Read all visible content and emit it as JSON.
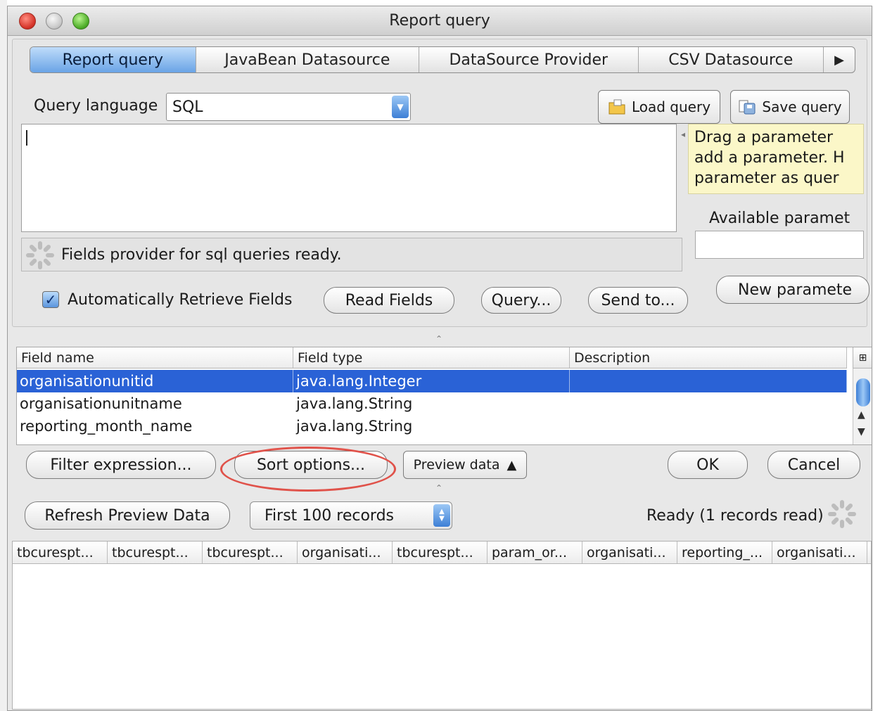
{
  "window": {
    "title": "Report query"
  },
  "tabs": [
    "Report query",
    "JavaBean Datasource",
    "DataSource Provider",
    "CSV Datasource"
  ],
  "query": {
    "language_label": "Query language",
    "language_value": "SQL",
    "load_label": "Load query",
    "save_label": "Save query",
    "text": "",
    "status": "Fields provider for sql queries ready.",
    "auto_retrieve_label": "Automatically Retrieve Fields",
    "auto_retrieve_checked": true,
    "read_fields_label": "Read Fields",
    "query_designer_label": "Query...",
    "send_to_label": "Send to..."
  },
  "parameters": {
    "hint_lines": [
      "Drag a parameter",
      "add a parameter. H",
      "parameter as quer"
    ],
    "available_label": "Available paramet",
    "new_label": "New paramete"
  },
  "fields": {
    "headers": [
      "Field name",
      "Field type",
      "Description"
    ],
    "rows": [
      {
        "name": "organisationunitid",
        "type": "java.lang.Integer",
        "description": "",
        "selected": true
      },
      {
        "name": "organisationunitname",
        "type": "java.lang.String",
        "description": "",
        "selected": false
      },
      {
        "name": "reporting_month_name",
        "type": "java.lang.String",
        "description": "",
        "selected": false
      }
    ]
  },
  "actions": {
    "filter_label": "Filter expression...",
    "sort_label": "Sort options...",
    "preview_label": "Preview data",
    "ok_label": "OK",
    "cancel_label": "Cancel"
  },
  "preview": {
    "refresh_label": "Refresh Preview Data",
    "records_value": "First 100 records",
    "status": "Ready (1 records read)",
    "columns": [
      "tbcurespt...",
      "tbcurespt...",
      "tbcurespt...",
      "organisati...",
      "tbcurespt...",
      "param_or...",
      "organisati...",
      "reporting_...",
      "organisati..."
    ]
  },
  "colors": {
    "selection": "#2a62d6",
    "highlight": "#e0524a",
    "tab_active": "#6aa4e6",
    "tooltip": "#fbf7c8"
  }
}
